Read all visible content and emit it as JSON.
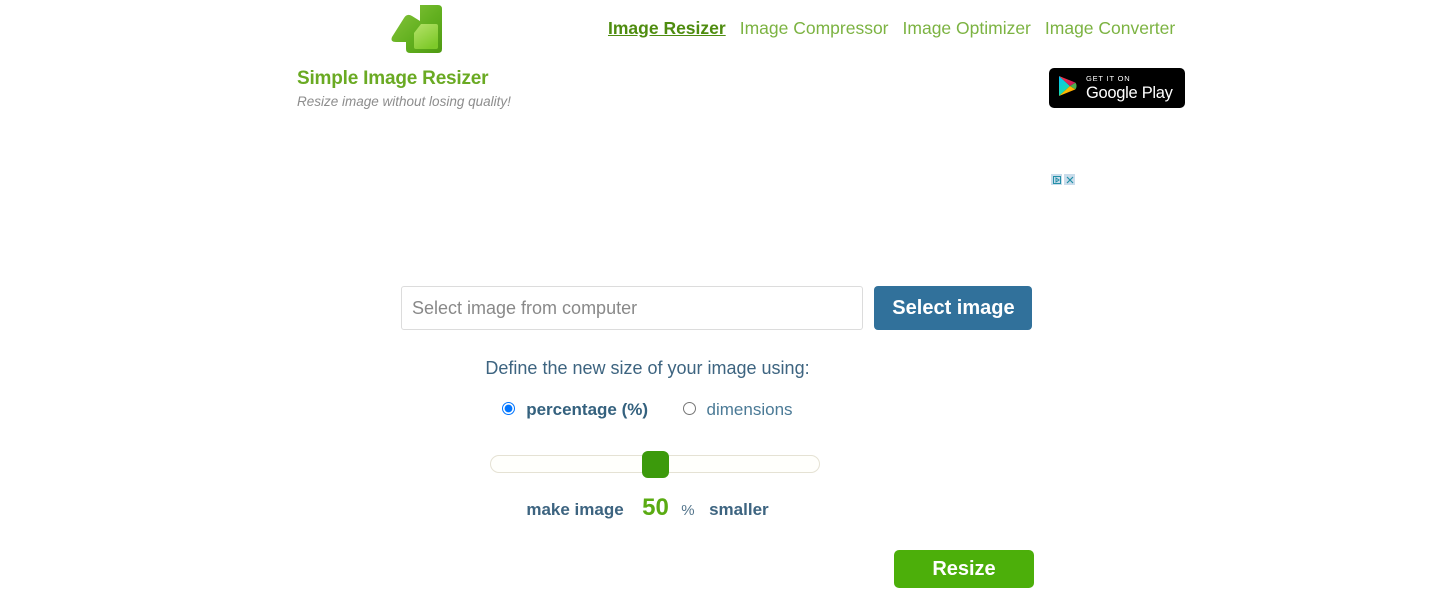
{
  "header": {
    "logo_icon": "resize-arrow-logo-icon",
    "site_title": "Simple Image Resizer",
    "tagline": "Resize image without losing quality!",
    "nav": [
      {
        "label": "Image Resizer",
        "active": true
      },
      {
        "label": "Image Compressor",
        "active": false
      },
      {
        "label": "Image Optimizer",
        "active": false
      },
      {
        "label": "Image Converter",
        "active": false
      }
    ],
    "google_play": {
      "small_label": "GET IT ON",
      "big_label": "Google Play",
      "icon": "google-play-triangle-icon"
    }
  },
  "ad": {
    "adchoices_arrow_icon": "adchoices-arrow-icon",
    "adchoices_close_icon": "adchoices-close-icon"
  },
  "form": {
    "file_input_placeholder": "Select image from computer",
    "file_input_value": "",
    "select_image_label": "Select image",
    "define_size_label": "Define the new size of your image using:",
    "options": {
      "percentage_label": "percentage (%)",
      "dimensions_label": "dimensions",
      "selected": "percentage"
    },
    "slider": {
      "value": 50,
      "min": 0,
      "max": 100
    },
    "make_image_prefix": "make image",
    "percent_value": "50",
    "percent_sign": "%",
    "make_image_suffix": "smaller",
    "resize_label": "Resize"
  },
  "colors": {
    "brand_green": "#6aaa23",
    "nav_green": "#7cb342",
    "active_nav_green": "#4e8c0f",
    "slider_handle_green": "#3c9a0c",
    "resize_green": "#4caf0a",
    "select_button_blue": "#31719b",
    "text_blue": "#3d6480",
    "percent_green": "#5aab13",
    "tagline_grey": "#8d8d8d",
    "page_background": "#ffffff"
  }
}
